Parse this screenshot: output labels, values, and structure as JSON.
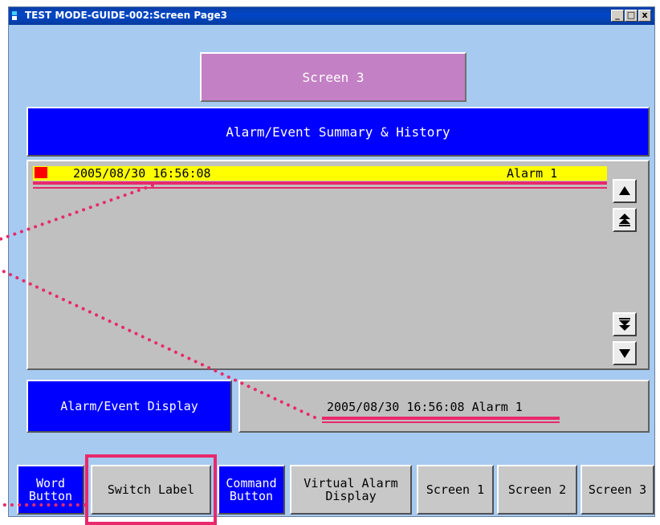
{
  "window": {
    "title": "TEST MODE-GUIDE-002:Screen Page3",
    "controls": {
      "minimize": "_",
      "maximize": "□",
      "close": "x"
    }
  },
  "screen_title": "Screen 3",
  "summary_header": "Alarm/Event Summary & History",
  "alarm_list": {
    "rows": [
      {
        "timestamp": "2005/08/30 16:56:08",
        "message": "Alarm 1",
        "status_color": "#ff0000"
      }
    ],
    "scroll_buttons": [
      "scroll-up",
      "page-up",
      "page-down",
      "scroll-down"
    ]
  },
  "alarm_display": {
    "label": "Alarm/Event Display",
    "value": "2005/08/30 16:56:08 Alarm 1"
  },
  "bottom_buttons": [
    {
      "label": "Word\nButton",
      "style": "blue"
    },
    {
      "label": "Switch Label",
      "style": "grey"
    },
    {
      "label": "Command\nButton",
      "style": "blue"
    },
    {
      "label": "Virtual Alarm\nDisplay",
      "style": "grey"
    },
    {
      "label": "Screen 1",
      "style": "grey"
    },
    {
      "label": "Screen 2",
      "style": "grey"
    },
    {
      "label": "Screen 3",
      "style": "grey"
    }
  ],
  "colors": {
    "background": "#a6caf0",
    "highlight": "#e8296b",
    "blue_panel": "#0000ff",
    "screen_title_bg": "#c380c4",
    "alarm_row_bg": "#ffff00"
  }
}
